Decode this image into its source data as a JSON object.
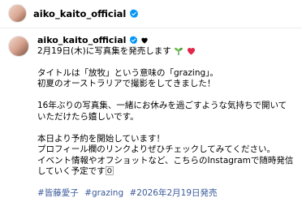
{
  "header": {
    "username": "aiko_kaito_official",
    "verified_icon": "verified-badge-icon"
  },
  "post": {
    "username": "aiko_kaito_official",
    "verified_icon": "verified-badge-icon",
    "heart_icon": "black-heart-icon",
    "lines_block1": [
      "2月19日(木)に写真集を発売します"
    ],
    "emojis_block1": [
      "seedling-icon",
      "red-heart-icon"
    ],
    "lines_block2": [
      "タイトルは「放牧」という意味の「grazing」。",
      "初夏のオーストラリアで撮影をしてきました！"
    ],
    "lines_block3": [
      "16年ぶりの写真集、一緒にお休みを過ごすような気持ちで開いて",
      "いただけたら嬉しいです。"
    ],
    "lines_block4": [
      "本日より予約を開始しています！",
      "プロフィール欄のリンクよりぜひチェックしてみてください。",
      "イベント情報やオフショットなど、こちらのInstagramで随時発信",
      "していく予定です🄾"
    ],
    "hashtags": [
      "#皆藤愛子",
      "#grazing",
      "#2026年2月19日発売"
    ]
  }
}
